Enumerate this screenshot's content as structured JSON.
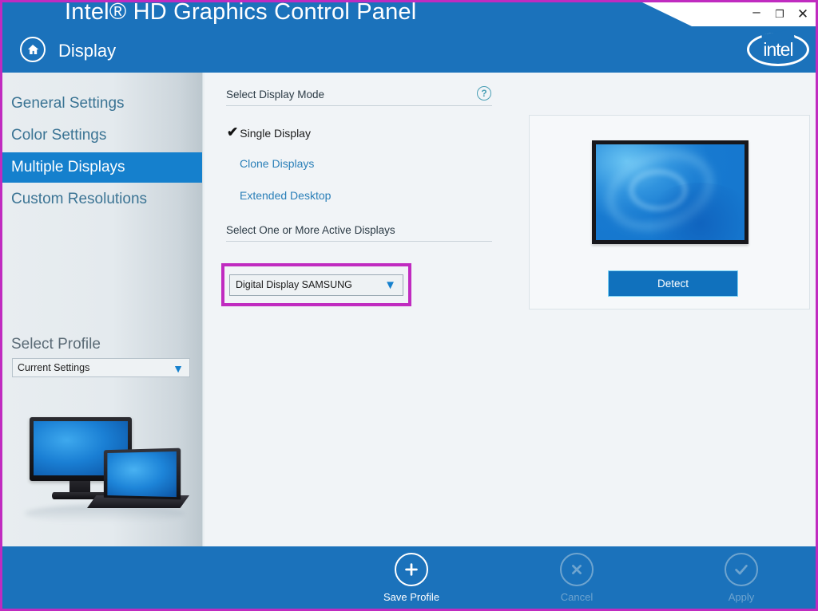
{
  "window": {
    "title": "Intel® HD Graphics Control Panel",
    "minimize_label": "–",
    "maximize_label": "❐",
    "close_label": "✕",
    "brand_logo_text": "intel",
    "home_icon": "home-icon",
    "page_title": "Display"
  },
  "sidebar": {
    "items": [
      {
        "label": "General Settings",
        "active": false
      },
      {
        "label": "Color Settings",
        "active": false
      },
      {
        "label": "Multiple Displays",
        "active": true
      },
      {
        "label": "Custom Resolutions",
        "active": false
      }
    ],
    "profile": {
      "label": "Select Profile",
      "selected": "Current Settings",
      "caret_icon": "chevron-down-icon"
    },
    "illustration": "monitor-and-laptop-illustration"
  },
  "main": {
    "display_mode": {
      "heading": "Select Display Mode",
      "help_icon": "help-icon",
      "help_glyph": "?",
      "selected_check": "✔",
      "options": [
        {
          "label": "Single Display",
          "selected": true
        },
        {
          "label": "Clone Displays",
          "selected": false
        },
        {
          "label": "Extended Desktop",
          "selected": false
        }
      ]
    },
    "active_displays": {
      "heading": "Select One or More Active Displays",
      "selected": "Digital Display SAMSUNG",
      "caret_icon": "chevron-down-icon",
      "highlight_color": "#c02bc0"
    },
    "preview": {
      "monitor_alt": "display-preview-monitor",
      "detect_label": "Detect"
    }
  },
  "footer": {
    "buttons": [
      {
        "label": "Save Profile",
        "icon": "plus-icon",
        "enabled": true
      },
      {
        "label": "Cancel",
        "icon": "close-x-icon",
        "enabled": false
      },
      {
        "label": "Apply",
        "icon": "check-icon",
        "enabled": false
      }
    ]
  },
  "colors": {
    "accent_blue": "#1b72bb",
    "nav_active": "#1580cd",
    "link_blue": "#2a7fb8",
    "highlight_magenta": "#c02bc0",
    "page_bg": "#f1f4f7"
  }
}
